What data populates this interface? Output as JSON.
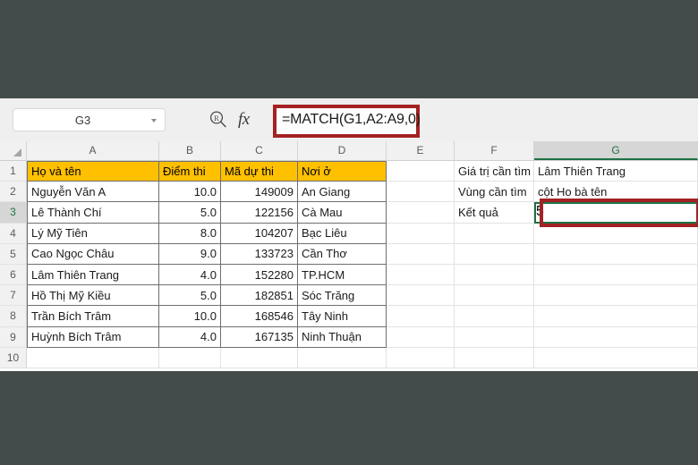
{
  "app": {
    "name_box_value": "G3",
    "formula": "=MATCH(G1,A2:A9,0)",
    "fx_label": "fx",
    "zoom_icon": "magnifier-icon",
    "dropdown_icon": "chevron-down-icon"
  },
  "grid": {
    "column_headers": [
      "A",
      "B",
      "C",
      "D",
      "E",
      "F",
      "G"
    ],
    "selected_column": "G",
    "row_headers": [
      "1",
      "2",
      "3",
      "4",
      "5",
      "6",
      "7",
      "8",
      "9",
      "10"
    ],
    "selected_row": "3",
    "selected_cell": "G3"
  },
  "table": {
    "headers": [
      "Họ và tên",
      "Điểm thi",
      "Mã dự thi",
      "Nơi ở"
    ],
    "rows": [
      [
        "Nguyễn Văn A",
        "10.0",
        "149009",
        "An Giang"
      ],
      [
        "Lê Thành Chí",
        "5.0",
        "122156",
        "Cà Mau"
      ],
      [
        "Lý Mỹ Tiên",
        "8.0",
        "104207",
        "Bạc Liêu"
      ],
      [
        "Cao Ngọc Châu",
        "9.0",
        "133723",
        "Cần Thơ"
      ],
      [
        "Lâm Thiên Trang",
        "4.0",
        "152280",
        "TP.HCM"
      ],
      [
        "Hồ Thị Mỹ Kiều",
        "5.0",
        "182851",
        "Sóc Trăng"
      ],
      [
        "Trần Bích Trâm",
        "10.0",
        "168546",
        "Tây Ninh"
      ],
      [
        "Huỳnh Bích Trâm",
        "4.0",
        "167135",
        "Ninh Thuận"
      ]
    ]
  },
  "panel": {
    "labels": [
      "Giá trị cần tìm",
      "Vùng cần tìm",
      "Kết quả"
    ],
    "values": [
      "Lâm Thiên Trang",
      "cột Ho bà tên",
      "5"
    ]
  },
  "colors": {
    "header_fill": "#FFC000",
    "selection_green": "#1E7145",
    "annotation_red": "#A32224",
    "letterbox": "#434C4A"
  }
}
